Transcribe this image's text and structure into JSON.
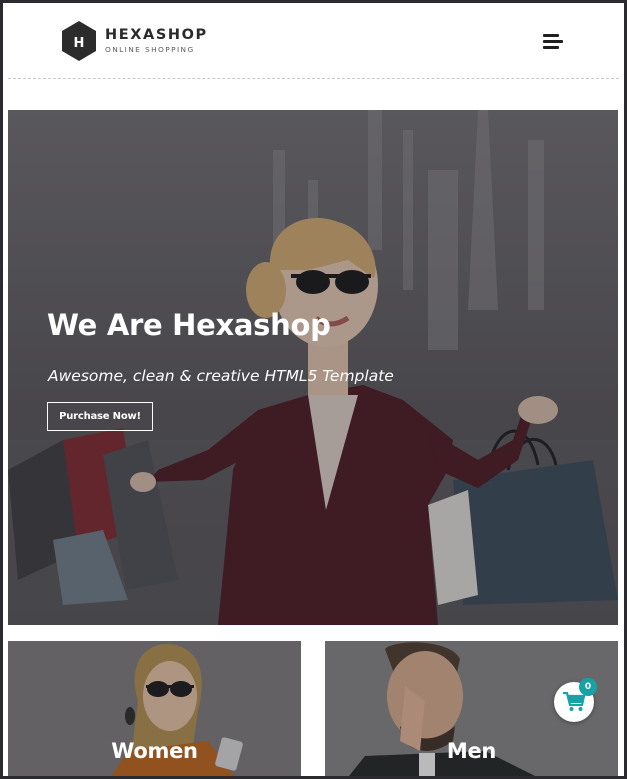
{
  "brand": {
    "logo_letter": "H",
    "name": "HEXASHOP",
    "tagline": "ONLINE SHOPPING"
  },
  "header": {
    "menu_icon": "hamburger-menu-icon"
  },
  "hero": {
    "title": "We Are Hexashop",
    "subtitle": "Awesome, clean & creative HTML5 Template",
    "cta_label": "Purchase Now!"
  },
  "categories": [
    {
      "label": "Women"
    },
    {
      "label": "Men"
    }
  ],
  "cart": {
    "icon": "shopping-cart-icon",
    "count": "0"
  },
  "colors": {
    "logo_hex": "#2c2c2c",
    "cart_icon": "#17a2a5",
    "badge": "#17a2a5",
    "text_on_image": "#ffffff"
  }
}
